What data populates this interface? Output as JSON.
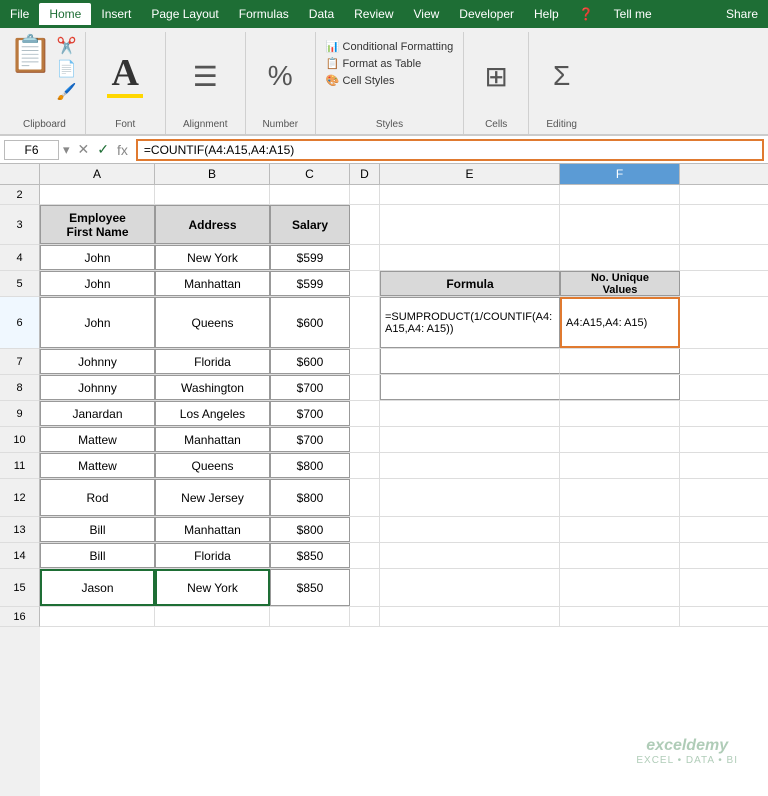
{
  "menu": {
    "items": [
      "File",
      "Home",
      "Insert",
      "Page Layout",
      "Formulas",
      "Data",
      "Review",
      "View",
      "Developer",
      "Help",
      "?",
      "Tell me",
      "Share"
    ],
    "active": "Home"
  },
  "ribbon": {
    "clipboard_label": "Clipboard",
    "font_label": "Font",
    "alignment_label": "Alignment",
    "number_label": "Number",
    "styles_label": "Styles",
    "cells_label": "Cells",
    "editing_label": "Editing",
    "styles_items": [
      "Conditional Formatting",
      "Format as Table",
      "Cell Styles"
    ]
  },
  "formula_bar": {
    "cell_ref": "F6",
    "formula": "=COUNTIF(A4:A15,A4:A15)"
  },
  "columns": [
    "A",
    "B",
    "C",
    "D",
    "E",
    "F"
  ],
  "rows": {
    "headers": [
      2,
      3,
      4,
      5,
      6,
      7,
      8,
      9,
      10,
      11,
      12,
      13,
      14,
      15,
      16
    ],
    "data": [
      {
        "row": 2,
        "cells": [
          "",
          "",
          "",
          "",
          "",
          ""
        ]
      },
      {
        "row": 3,
        "cells": [
          "Employee\nFirst Name",
          "Address",
          "Salary",
          "",
          "",
          ""
        ]
      },
      {
        "row": 4,
        "cells": [
          "John",
          "New York",
          "$599",
          "",
          "",
          ""
        ]
      },
      {
        "row": 5,
        "cells": [
          "John",
          "Manhattan",
          "$599",
          "",
          "Formula",
          "No. Unique\nValues"
        ]
      },
      {
        "row": 6,
        "cells": [
          "John",
          "Queens",
          "$600",
          "",
          "=SUMPRODUCT(1/COUNTIF(A4:A15,A4:",
          "A4:A15,A4:\nA15)"
        ]
      },
      {
        "row": 7,
        "cells": [
          "Johnny",
          "Florida",
          "$600",
          "",
          "",
          ""
        ]
      },
      {
        "row": 8,
        "cells": [
          "Johnny",
          "Washington",
          "$700",
          "",
          "",
          ""
        ]
      },
      {
        "row": 9,
        "cells": [
          "Janardan",
          "Los Angeles",
          "$700",
          "",
          "",
          ""
        ]
      },
      {
        "row": 10,
        "cells": [
          "Mattew",
          "Manhattan",
          "$700",
          "",
          "",
          ""
        ]
      },
      {
        "row": 11,
        "cells": [
          "Mattew",
          "Queens",
          "$800",
          "",
          "",
          ""
        ]
      },
      {
        "row": 12,
        "cells": [
          "Rod",
          "New Jersey",
          "$800",
          "",
          "",
          ""
        ]
      },
      {
        "row": 13,
        "cells": [
          "Bill",
          "Manhattan",
          "$800",
          "",
          "",
          ""
        ]
      },
      {
        "row": 14,
        "cells": [
          "Bill",
          "Florida",
          "$850",
          "",
          "",
          ""
        ]
      },
      {
        "row": 15,
        "cells": [
          "Jason",
          "New York",
          "$850",
          "",
          "",
          ""
        ]
      },
      {
        "row": 16,
        "cells": [
          "",
          "",
          "",
          "",
          "",
          ""
        ]
      }
    ]
  },
  "side_table": {
    "col1_header": "Formula",
    "col2_header": "No. Unique\nValues",
    "rows": [
      {
        "formula": "=SUMPRODUCT(1/COUNTIF(A4:A15,A4:\nA15))",
        "value": "A4:A15,A4:\nA15)"
      },
      {
        "formula": "",
        "value": ""
      },
      {
        "formula": "",
        "value": ""
      }
    ]
  },
  "watermark": "exceldemy\nEXCEL • DATA • BI"
}
